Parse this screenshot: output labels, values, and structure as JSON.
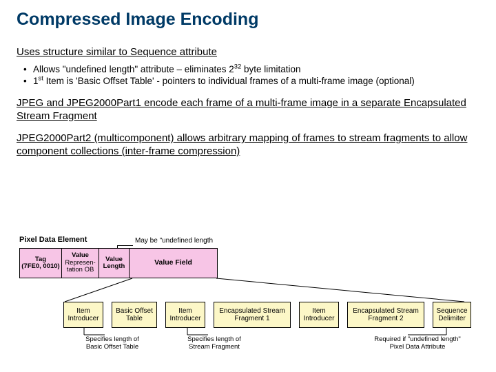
{
  "title": "Compressed Image Encoding",
  "para1": "Uses structure similar to Sequence attribute",
  "bullets": [
    {
      "pre": "Allows \"undefined length\" attribute – eliminates 2",
      "sup": "32",
      "post": " byte limitation"
    },
    {
      "pre": "1",
      "sup": "st",
      "post": " Item is 'Basic Offset Table' - pointers to individual frames of a multi-frame image (optional)"
    }
  ],
  "para2": "JPEG and JPEG2000Part1 encode each frame of a multi-frame image in a separate Encapsulated Stream Fragment",
  "para3": "JPEG2000Part2 (multicomponent) allows arbitrary mapping of frames to stream fragments to allow component collections (inter-frame compression)",
  "diagram": {
    "pixelDataLabel": "Pixel Data Element",
    "undefLabel": "May be \"undefined length",
    "top": {
      "tag": {
        "l1": "Tag",
        "l2": "(7FE0, 0010)"
      },
      "vr": {
        "l1": "Value",
        "l2": "Represen-",
        "l3": "tation OB"
      },
      "vl": {
        "l1": "Value",
        "l2": "Length"
      },
      "vf": "Value Field"
    },
    "bottom": {
      "item1": {
        "l1": "Item",
        "l2": "Introducer"
      },
      "bot": {
        "l1": "Basic Offset",
        "l2": "Table"
      },
      "item2": {
        "l1": "Item",
        "l2": "Introducer"
      },
      "frag1": {
        "l1": "Encapsulated Stream",
        "l2": "Fragment 1"
      },
      "item3": {
        "l1": "Item",
        "l2": "Introducer"
      },
      "frag2": {
        "l1": "Encapsulated Stream",
        "l2": "Fragment 2"
      },
      "seq": {
        "l1": "Sequence",
        "l2": "Delimiter"
      }
    },
    "captions": {
      "c1": {
        "l1": "Specifies length of",
        "l2": "Basic Offset Table"
      },
      "c2": {
        "l1": "Specifies length of",
        "l2": "Stream Fragment"
      },
      "c3": {
        "l1": "Required if \"undefined length\"",
        "l2": "Pixel Data Attribute"
      }
    }
  }
}
